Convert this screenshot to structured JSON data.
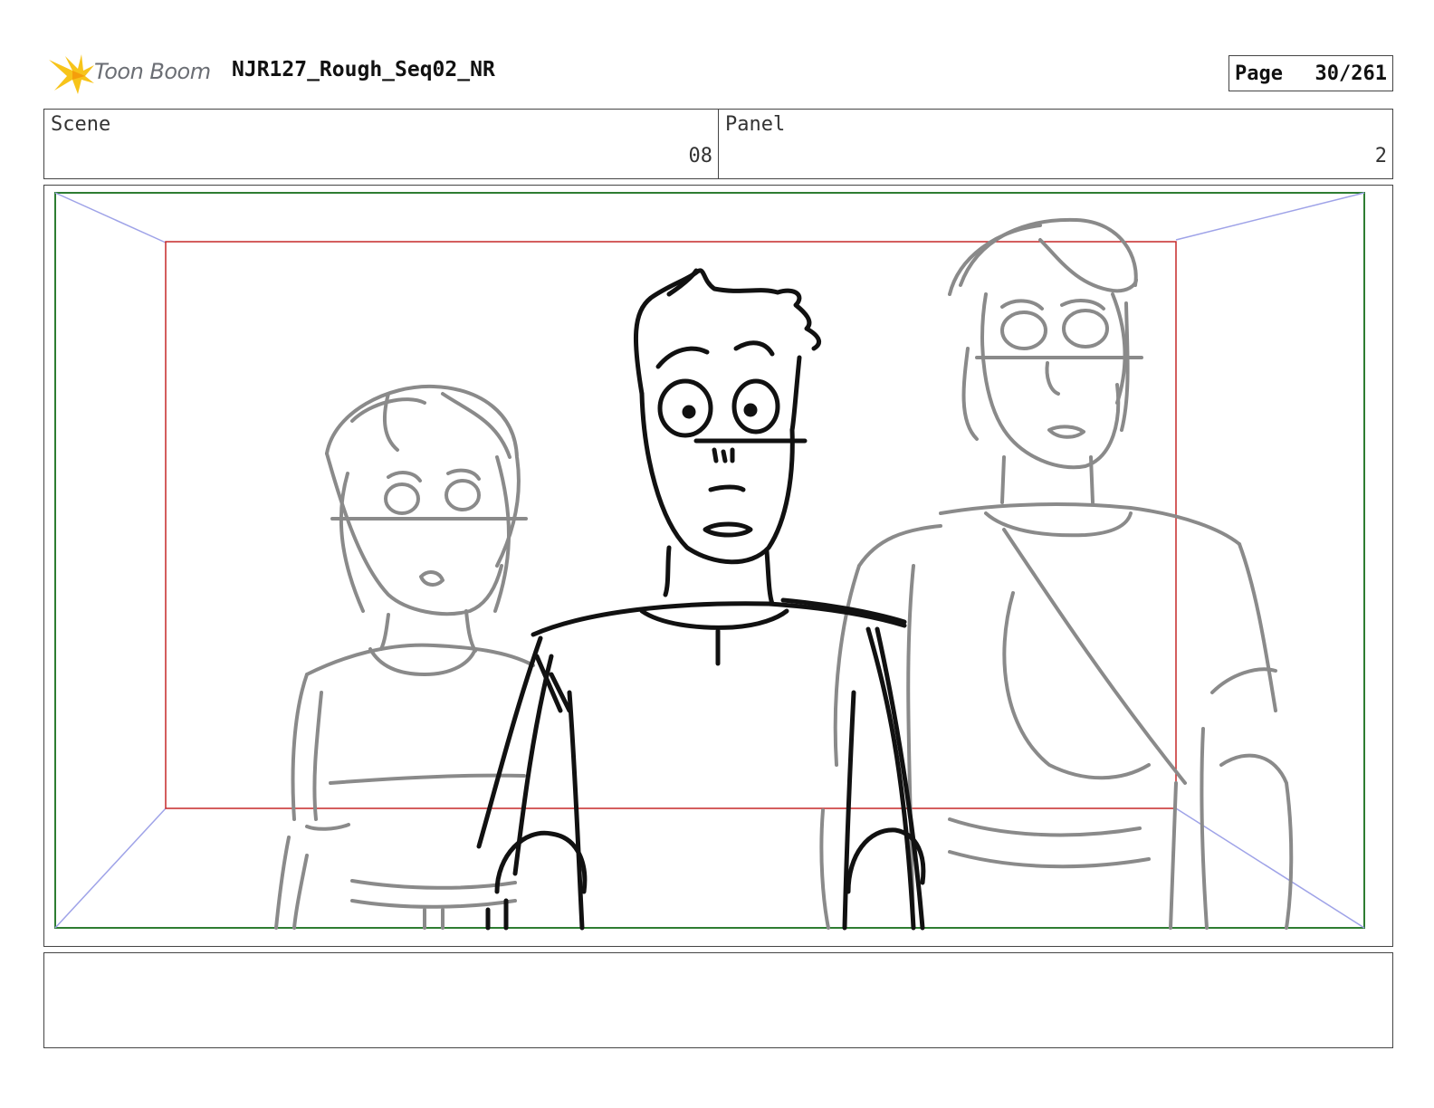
{
  "header": {
    "logo_text": "Toon Boom",
    "project_title": "NJR127_Rough_Seq02_NR",
    "page_label": "Page",
    "page_number": "30/261"
  },
  "info": {
    "scene_label": "Scene",
    "scene_value": "08",
    "panel_label": "Panel",
    "panel_value": "2"
  },
  "notes": {
    "text": ""
  },
  "colors": {
    "outer_frame": "#2e7d32",
    "camera_frame": "#c62828",
    "camera_guides": "#9fa3e8",
    "ink_dark": "#111111",
    "ink_gray": "#8a8a8a",
    "logo_yellow": "#f7c41a"
  }
}
